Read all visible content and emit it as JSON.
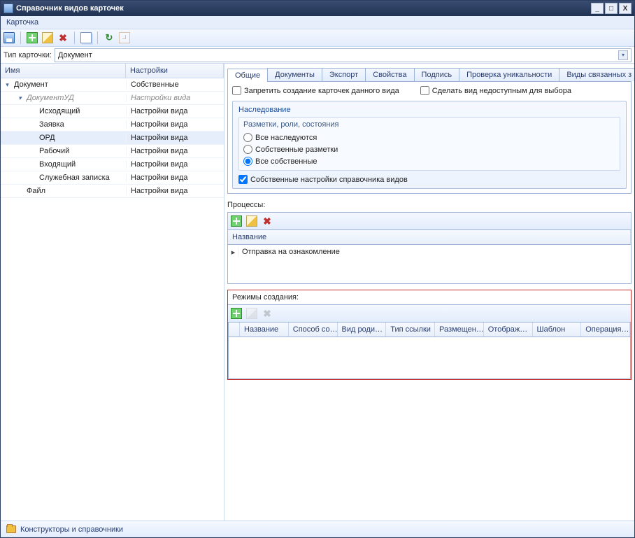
{
  "window": {
    "title": "Справочник видов карточек"
  },
  "menubar": {
    "card": "Карточка"
  },
  "typebar": {
    "label": "Тип карточки:",
    "value": "Документ"
  },
  "tree": {
    "head": {
      "name": "Имя",
      "settings": "Настройки"
    },
    "rows": [
      {
        "indent": 0,
        "label": "Документ",
        "set": "Собственные",
        "exp": "▾"
      },
      {
        "indent": 1,
        "label": "ДокументУД",
        "set": "Настройки вида",
        "exp": "▾",
        "italic": true
      },
      {
        "indent": 2,
        "label": "Исходящий",
        "set": "Настройки вида"
      },
      {
        "indent": 2,
        "label": "Заявка",
        "set": "Настройки вида"
      },
      {
        "indent": 2,
        "label": "ОРД",
        "set": "Настройки вида",
        "sel": true
      },
      {
        "indent": 2,
        "label": "Рабочий",
        "set": "Настройки вида"
      },
      {
        "indent": 2,
        "label": "Входящий",
        "set": "Настройки вида"
      },
      {
        "indent": 2,
        "label": "Служебная записка",
        "set": "Настройки вида"
      },
      {
        "indent": 1,
        "label": "Файл",
        "set": "Настройки вида"
      }
    ]
  },
  "tabs": {
    "items": [
      "Общие",
      "Документы",
      "Экспорт",
      "Свойства",
      "Подпись",
      "Проверка уникальности",
      "Виды связанных з"
    ],
    "active": 0
  },
  "general": {
    "forbid": "Запретить создание карточек данного вида",
    "hide": "Сделать вид недоступным для выбора",
    "inherit_title": "Наследование",
    "sub_title": "Разметки, роли, состояния",
    "r1": "Все наследуются",
    "r2": "Собственные разметки",
    "r3": "Все собственные",
    "own_settings": "Собственные настройки справочника видов"
  },
  "processes": {
    "label": "Процессы:",
    "head": "Название",
    "row": "Отправка на ознакомление"
  },
  "modes": {
    "label": "Режимы создания:",
    "cols": [
      "Название",
      "Способ со…",
      "Вид роди…",
      "Тип ссылки",
      "Размещен…",
      "Отображ…",
      "Шаблон",
      "Операция…"
    ]
  },
  "status": {
    "text": "Конструкторы и справочники"
  }
}
